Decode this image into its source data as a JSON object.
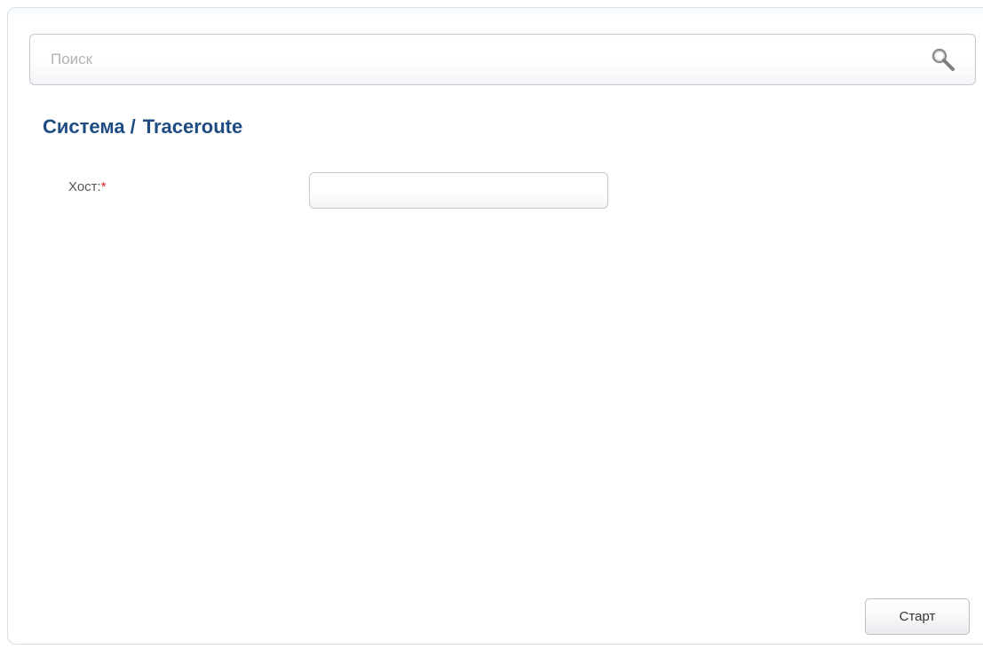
{
  "search": {
    "placeholder": "Поиск",
    "icon": "search-icon"
  },
  "header": {
    "section": "Система",
    "separator": "/",
    "page": "Traceroute",
    "color": "#1e4c82"
  },
  "form": {
    "host_label": "Хост:",
    "required_mark": "*",
    "host_value": ""
  },
  "actions": {
    "start_label": "Старт"
  }
}
